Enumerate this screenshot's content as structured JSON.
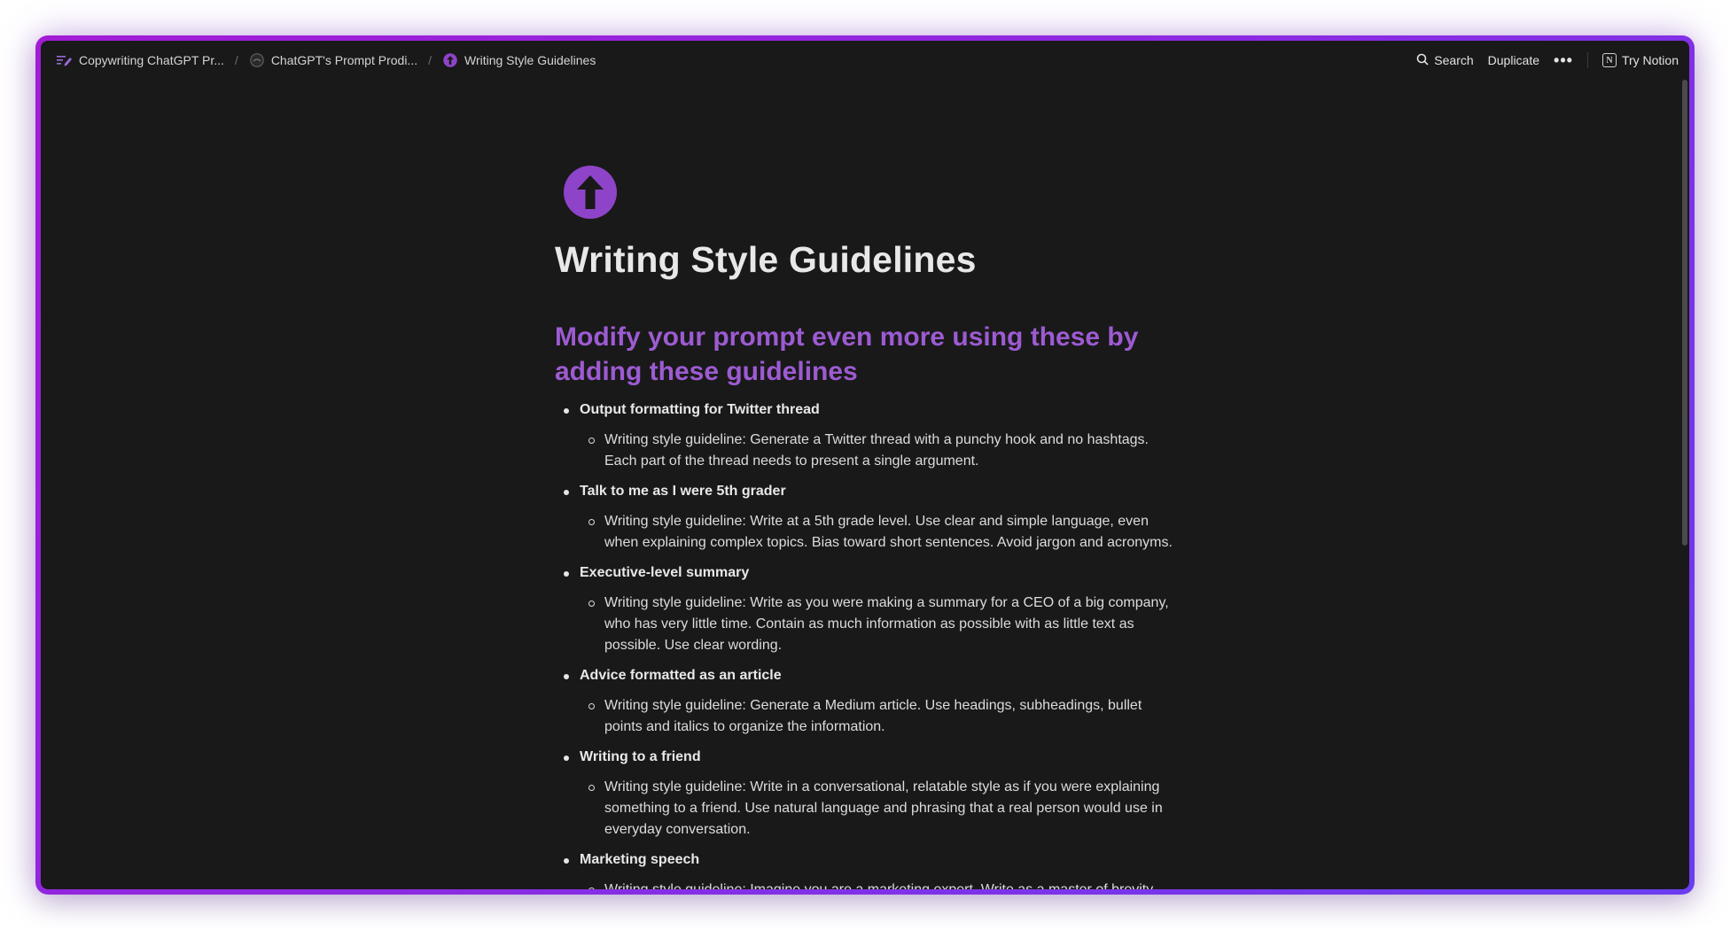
{
  "breadcrumb": [
    {
      "label": "Copywriting ChatGPT Pr...",
      "icon": "edit-lines-icon"
    },
    {
      "label": "ChatGPT's Prompt Prodi...",
      "icon": "avatar-icon"
    },
    {
      "label": "Writing Style Guidelines",
      "icon": "up-arrow-circle-icon"
    }
  ],
  "breadcrumb_separator": "/",
  "topbar": {
    "search_label": "Search",
    "duplicate_label": "Duplicate",
    "more_label": "•••",
    "try_notion_label": "Try Notion",
    "notion_logo_letter": "N"
  },
  "page": {
    "icon": "up-arrow-circle-icon",
    "icon_color": "#8e44c8",
    "title": "Writing Style Guidelines",
    "subtitle": "Modify your prompt even more using these by adding these guidelines",
    "items": [
      {
        "title": "Output formatting for Twitter thread",
        "detail": "Writing style guideline: Generate a Twitter thread with a punchy hook and no hashtags. Each part of the thread needs to present a single argument."
      },
      {
        "title": "Talk to me as I were 5th grader",
        "detail": "Writing style guideline: Write at a 5th grade level. Use clear and simple language, even when explaining complex topics. Bias toward short sentences. Avoid jargon and acronyms."
      },
      {
        "title": "Executive-level summary",
        "detail": "Writing style guideline: Write as you were making a summary for a CEO of a big company, who has very little time. Contain as much information as possible with as little text as possible. Use clear wording."
      },
      {
        "title": "Advice formatted as an article",
        "detail": "Writing style guideline: Generate a Medium article. Use headings, subheadings, bullet points and italics to organize the information."
      },
      {
        "title": "Writing to a friend",
        "detail": "Writing style guideline: Write in a conversational, relatable style as if you were explaining something to a friend. Use natural language and phrasing that a real person would use in everyday conversation."
      },
      {
        "title": "Marketing speech",
        "detail": "Writing style guideline: Imagine you are a marketing expert. Write as a master of brevity"
      }
    ]
  },
  "colors": {
    "frame_gradient_start": "#a21cd6",
    "frame_gradient_end": "#6a3df0",
    "background": "#191919",
    "accent_heading": "#9d5bd2"
  }
}
